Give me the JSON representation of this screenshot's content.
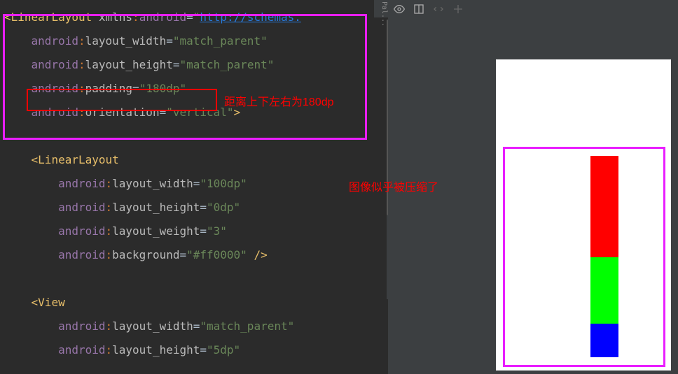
{
  "sidebar": {
    "palette_label": "Pal..."
  },
  "toolbar": {
    "icons": [
      "eye-icon",
      "columns-icon",
      "swap-icon",
      "arrows-icon"
    ]
  },
  "code": {
    "line1": {
      "tag": "LinearLayout",
      "ns_attr": "xmlns",
      "ns_name": "android",
      "url": "http://schemas."
    },
    "line2": {
      "ns": "android",
      "attr": "layout_width",
      "val": "\"match_parent\""
    },
    "line3": {
      "ns": "android",
      "attr": "layout_height",
      "val": "\"match_parent\""
    },
    "line4": {
      "ns": "android",
      "attr": "padding",
      "val": "\"180dp\""
    },
    "line5": {
      "ns": "android",
      "attr": "orientation",
      "val": "\"vertical\"",
      "close": ">"
    },
    "line6": {
      "tag": "LinearLayout"
    },
    "line7": {
      "ns": "android",
      "attr": "layout_width",
      "val": "\"100dp\""
    },
    "line8": {
      "ns": "android",
      "attr": "layout_height",
      "val": "\"0dp\""
    },
    "line9": {
      "ns": "android",
      "attr": "layout_weight",
      "val": "\"3\""
    },
    "line10": {
      "ns": "android",
      "attr": "background",
      "val": "\"#ff0000\"",
      "selfclose": " />"
    },
    "line11": {
      "tag": "View"
    },
    "line12": {
      "ns": "android",
      "attr": "layout_width",
      "val": "\"match_parent\""
    },
    "line13": {
      "ns": "android",
      "attr": "layout_height",
      "val": "\"5dp\""
    }
  },
  "annotations": {
    "padding_note": "距离上下左右为180dp",
    "compress_note": "图像似乎被压缩了"
  },
  "preview": {
    "colors": {
      "red": "#ff0000",
      "green": "#00ff00",
      "blue": "#0000ff"
    }
  }
}
